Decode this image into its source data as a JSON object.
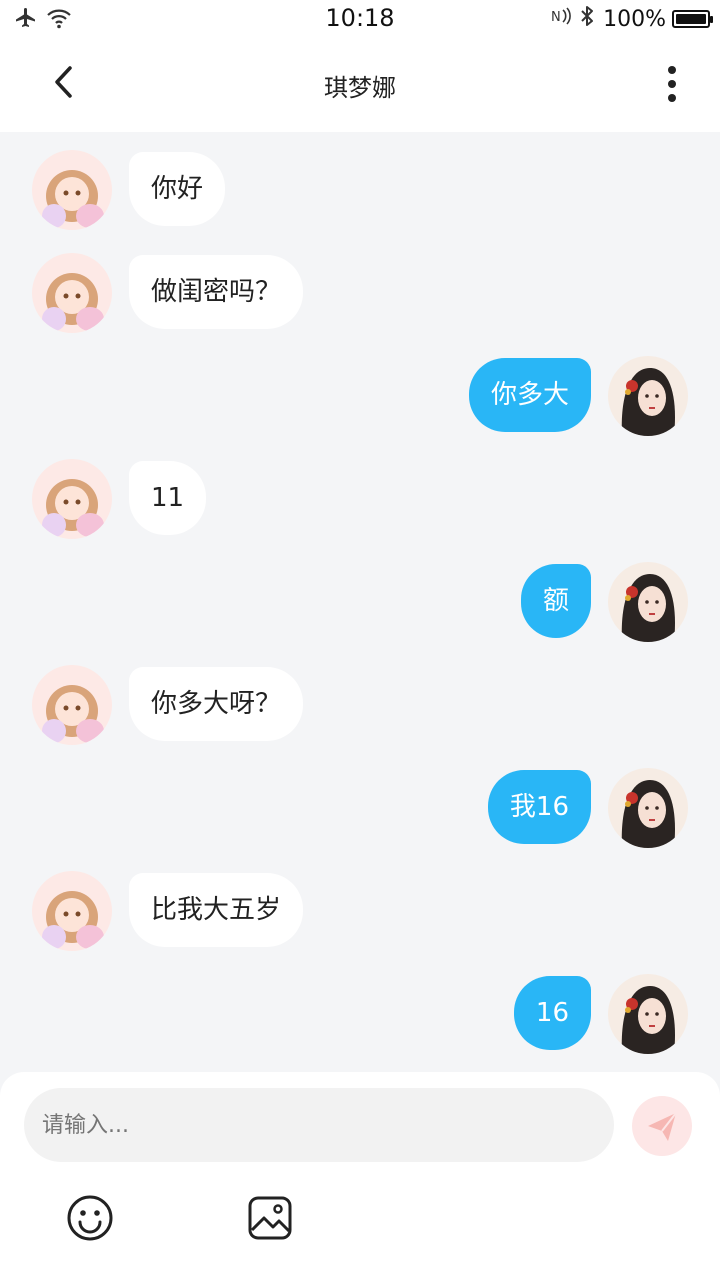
{
  "status_bar": {
    "time": "10:18",
    "battery": "100%",
    "battery_level": 1.0,
    "icons": [
      "airplane-icon",
      "wifi-icon",
      "nfc-icon",
      "bluetooth-icon",
      "battery-icon"
    ]
  },
  "header": {
    "title": "琪梦娜",
    "back_icon": "chevron-left-icon",
    "more_icon": "more-vertical-icon"
  },
  "messages": [
    {
      "side": "left",
      "text": "你好"
    },
    {
      "side": "left",
      "text": "做闺密吗？"
    },
    {
      "side": "right",
      "text": "你多大"
    },
    {
      "side": "left",
      "text": "11"
    },
    {
      "side": "right",
      "text": "额"
    },
    {
      "side": "left",
      "text": "你多大呀？"
    },
    {
      "side": "right",
      "text": "我16"
    },
    {
      "side": "left",
      "text": "比我大五岁"
    },
    {
      "side": "right",
      "text": "16"
    }
  ],
  "composer": {
    "placeholder": "请输入...",
    "send_icon": "send-icon",
    "emoji_icon": "emoji-icon",
    "image_icon": "image-icon"
  },
  "colors": {
    "accent": "#29b6f6",
    "background": "#f4f5f7",
    "send_button": "#fde6e6"
  }
}
